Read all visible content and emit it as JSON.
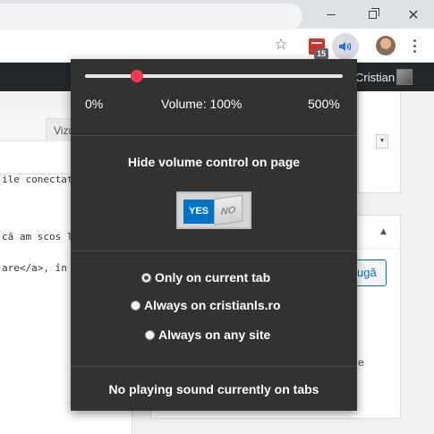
{
  "browser": {
    "extension_badge": "15",
    "colors": {
      "titlebar": "#dee1e6",
      "toolbar": "#ffffff",
      "calendar_ext": "#d93025"
    }
  },
  "wordpress": {
    "admin_user": "Cristian",
    "editor_tab": "Vizu",
    "code_lines": [
      "ile conectat",
      "că am scos l",
      "are</a>, în"
    ],
    "add_button": "ugă",
    "side_text": "e"
  },
  "popup": {
    "volume": {
      "min_label": "0%",
      "current_label": "Volume: 100%",
      "max_label": "500%",
      "level_percent": 100,
      "range_percent": [
        0,
        500
      ]
    },
    "hide_control": {
      "title": "Hide volume control on page",
      "yes_label": "YES",
      "no_label": "NO",
      "state": "yes"
    },
    "scope_options": [
      {
        "label": "Only on current tab",
        "checked": true
      },
      {
        "label": "Always on cristianls.ro",
        "checked": false
      },
      {
        "label": "Always on any site",
        "checked": false
      }
    ],
    "status": "No playing sound currently on tabs",
    "colors": {
      "background": "#333231",
      "knob": "#ef3b4f",
      "toggle_yes": "#0074c8"
    }
  }
}
